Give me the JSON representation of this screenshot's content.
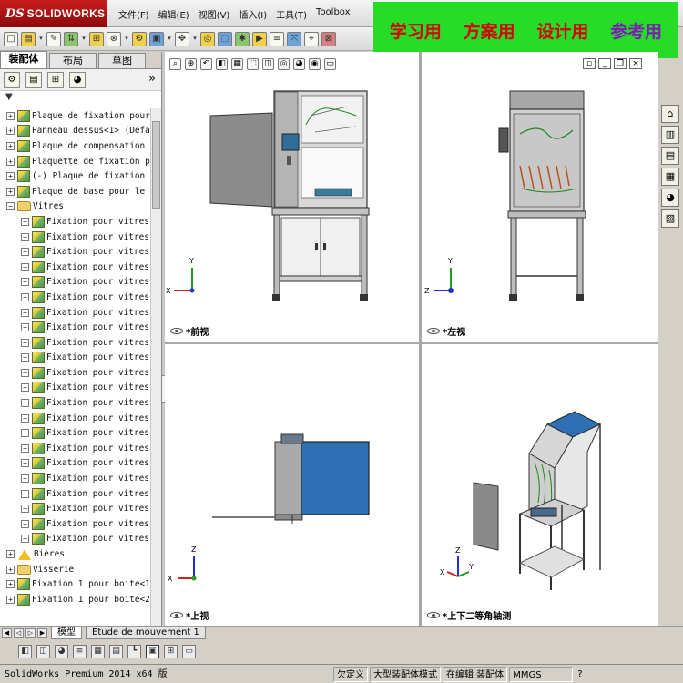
{
  "window": {
    "brand_ds": "DS",
    "brand_name": "SOLIDWORKS",
    "menu": [
      "文件(F)",
      "编辑(E)",
      "视图(V)",
      "插入(I)",
      "工具(T)",
      "Toolbox"
    ]
  },
  "promo": {
    "items": [
      "学习用",
      "方案用",
      "设计用",
      "参考用"
    ],
    "colors": [
      "#d80000",
      "#d80000",
      "#d80000",
      "#7a1cb4"
    ],
    "background": "#26dc26"
  },
  "panel": {
    "tabs": [
      "装配体",
      "布局",
      "草图"
    ],
    "more_glyph": "»",
    "filter_glyph": "▼",
    "tree": [
      {
        "label": "Plaque de fixation pour",
        "icon": "cube",
        "level": 1
      },
      {
        "label": "Panneau dessus<1> (Défau",
        "icon": "cube",
        "level": 1
      },
      {
        "label": "Plaque de compensation :",
        "icon": "cube",
        "level": 1
      },
      {
        "label": "Plaquette de fixation pe",
        "icon": "cube",
        "level": 1
      },
      {
        "label": "(-) Plaque de fixation p",
        "icon": "cube",
        "level": 1
      },
      {
        "label": "Plaque de base pour le l",
        "icon": "cube",
        "level": 1
      },
      {
        "label": "Vitres",
        "icon": "folder",
        "level": 1,
        "expanded": true
      },
      {
        "label": "Fixation pour vitres",
        "icon": "cube",
        "level": 2
      },
      {
        "label": "Fixation pour vitres",
        "icon": "cube",
        "level": 2
      },
      {
        "label": "Fixation pour vitres",
        "icon": "cube",
        "level": 2
      },
      {
        "label": "Fixation pour vitres",
        "icon": "cube",
        "level": 2
      },
      {
        "label": "Fixation pour vitres",
        "icon": "cube",
        "level": 2
      },
      {
        "label": "Fixation pour vitres",
        "icon": "cube",
        "level": 2
      },
      {
        "label": "Fixation pour vitres",
        "icon": "cube",
        "level": 2
      },
      {
        "label": "Fixation pour vitres",
        "icon": "cube",
        "level": 2
      },
      {
        "label": "Fixation pour vitres",
        "icon": "cube",
        "level": 2
      },
      {
        "label": "Fixation pour vitres",
        "icon": "cube",
        "level": 2
      },
      {
        "label": "Fixation pour vitres",
        "icon": "cube",
        "level": 2
      },
      {
        "label": "Fixation pour vitres",
        "icon": "cube",
        "level": 2
      },
      {
        "label": "Fixation pour vitres",
        "icon": "cube",
        "level": 2
      },
      {
        "label": "Fixation pour vitres",
        "icon": "cube",
        "level": 2
      },
      {
        "label": "Fixation pour vitres",
        "icon": "cube",
        "level": 2
      },
      {
        "label": "Fixation pour vitres",
        "icon": "cube",
        "level": 2
      },
      {
        "label": "Fixation pour vitres",
        "icon": "cube",
        "level": 2
      },
      {
        "label": "Fixation pour vitres",
        "icon": "cube",
        "level": 2
      },
      {
        "label": "Fixation pour vitres",
        "icon": "cube",
        "level": 2
      },
      {
        "label": "Fixation pour vitres",
        "icon": "cube",
        "level": 2
      },
      {
        "label": "Fixation pour vitres",
        "icon": "cube",
        "level": 2
      },
      {
        "label": "Fixation pour vitres",
        "icon": "cube",
        "level": 2
      },
      {
        "label": "Bières",
        "icon": "warning-folder",
        "level": 1
      },
      {
        "label": "Visserie",
        "icon": "folder",
        "level": 1
      },
      {
        "label": "Fixation 1 pour boite<1",
        "icon": "cube",
        "level": 1
      },
      {
        "label": "Fixation 1 pour boite<2",
        "icon": "cube",
        "level": 1
      }
    ]
  },
  "viewports": {
    "front": {
      "label": "*前视"
    },
    "left": {
      "label": "*左视"
    },
    "top": {
      "label": "*上视"
    },
    "iso": {
      "label": "*上下二等角轴测"
    }
  },
  "axis_letters": {
    "x": "X",
    "y": "Y",
    "z": "Z"
  },
  "bottom_tabs": [
    "模型",
    "Etude de mouvement 1"
  ],
  "status": {
    "product": "SolidWorks Premium 2014 x64 版",
    "items": [
      "欠定义",
      "大型装配体模式",
      "在编辑 装配体",
      "MMGS"
    ],
    "help": "?"
  },
  "colors": {
    "panel_blue": "#2f6fb3",
    "cabinet_gray": "#9a9a9a",
    "axis_x": "#d02020",
    "axis_y": "#20a020",
    "axis_z": "#2030d0"
  }
}
